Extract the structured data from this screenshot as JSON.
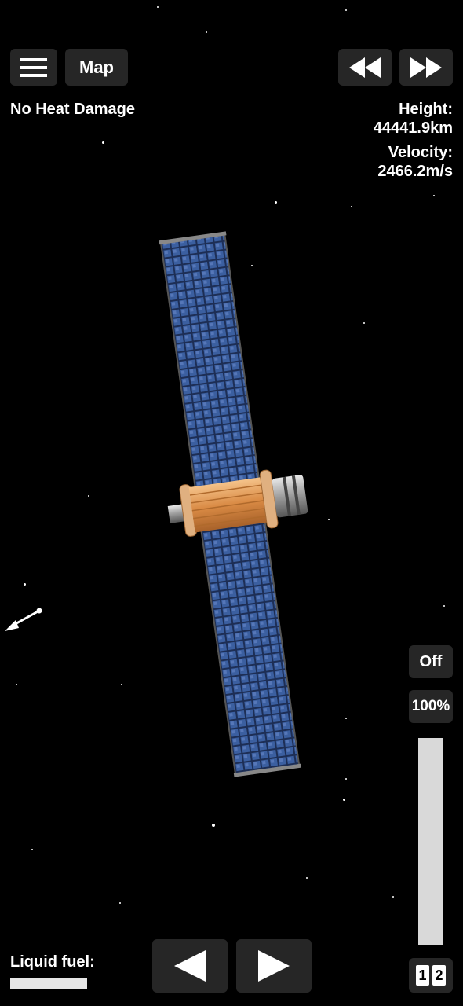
{
  "topbar": {
    "menu_icon": "hamburger-menu-icon",
    "map_label": "Map",
    "rewind_icon": "rewind-icon",
    "fast_forward_icon": "fast-forward-icon"
  },
  "status": {
    "heat": "No Heat Damage",
    "height_label": "Height:",
    "height_value": "44441.9km",
    "velocity_label": "Velocity:",
    "velocity_value": "2466.2m/s"
  },
  "throttle": {
    "toggle_label": "Off",
    "percent_label": "100%",
    "level": 1.0
  },
  "fuel": {
    "label": "Liquid fuel:",
    "level": 1.0
  },
  "controls": {
    "rotate_left_icon": "triangle-left-icon",
    "rotate_right_icon": "triangle-right-icon",
    "stage_one": "1",
    "stage_two": "2"
  },
  "colors": {
    "button_bg": "#262626",
    "panel_blue": "#3b5fa0",
    "body_orange": "#d9914a",
    "bar_fill": "#d9d9d9"
  }
}
